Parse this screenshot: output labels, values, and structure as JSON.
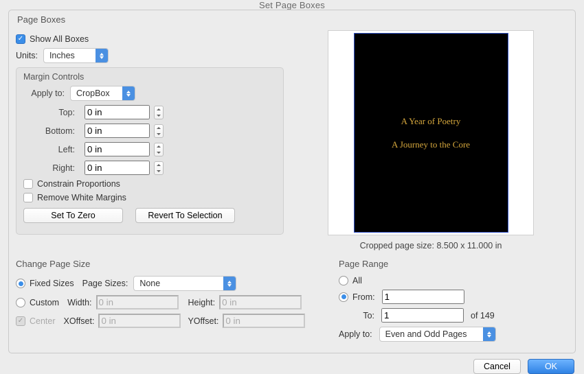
{
  "window_title": "Set Page Boxes",
  "page_boxes_label": "Page Boxes",
  "show_all_boxes": {
    "checked": true,
    "label": "Show All Boxes"
  },
  "units": {
    "label": "Units:",
    "value": "Inches"
  },
  "margin": {
    "title": "Margin Controls",
    "apply_to": {
      "label": "Apply to:",
      "value": "CropBox"
    },
    "top": {
      "label": "Top:",
      "value": "0 in"
    },
    "bottom": {
      "label": "Bottom:",
      "value": "0 in"
    },
    "left": {
      "label": "Left:",
      "value": "0 in"
    },
    "right": {
      "label": "Right:",
      "value": "0 in"
    },
    "constrain": {
      "checked": false,
      "label": "Constrain Proportions"
    },
    "remove_margins": {
      "checked": false,
      "label": "Remove White Margins"
    },
    "set_zero": "Set To Zero",
    "revert": "Revert To Selection"
  },
  "preview": {
    "line1": "A Year of Poetry",
    "line2": "A Journey to the Core",
    "cropped_label": "Cropped page size: 8.500 x 11.000 in"
  },
  "change_size": {
    "title": "Change Page Size",
    "fixed": {
      "selected": true,
      "label": "Fixed Sizes"
    },
    "page_sizes": {
      "label": "Page Sizes:",
      "value": "None"
    },
    "custom": {
      "selected": false,
      "label": "Custom"
    },
    "width": {
      "label": "Width:",
      "value": "0 in"
    },
    "height": {
      "label": "Height:",
      "value": "0 in"
    },
    "center": {
      "checked": true,
      "label": "Center"
    },
    "xoffset": {
      "label": "XOffset:",
      "value": "0 in"
    },
    "yoffset": {
      "label": "YOffset:",
      "value": "0 in"
    }
  },
  "page_range": {
    "title": "Page Range",
    "all": {
      "selected": false,
      "label": "All"
    },
    "from": {
      "selected": true,
      "label": "From:",
      "value": "1"
    },
    "to": {
      "label": "To:",
      "value": "1",
      "of_label": "of 149"
    },
    "apply_to": {
      "label": "Apply to:",
      "value": "Even and Odd Pages"
    }
  },
  "footer": {
    "cancel": "Cancel",
    "ok": "OK"
  }
}
